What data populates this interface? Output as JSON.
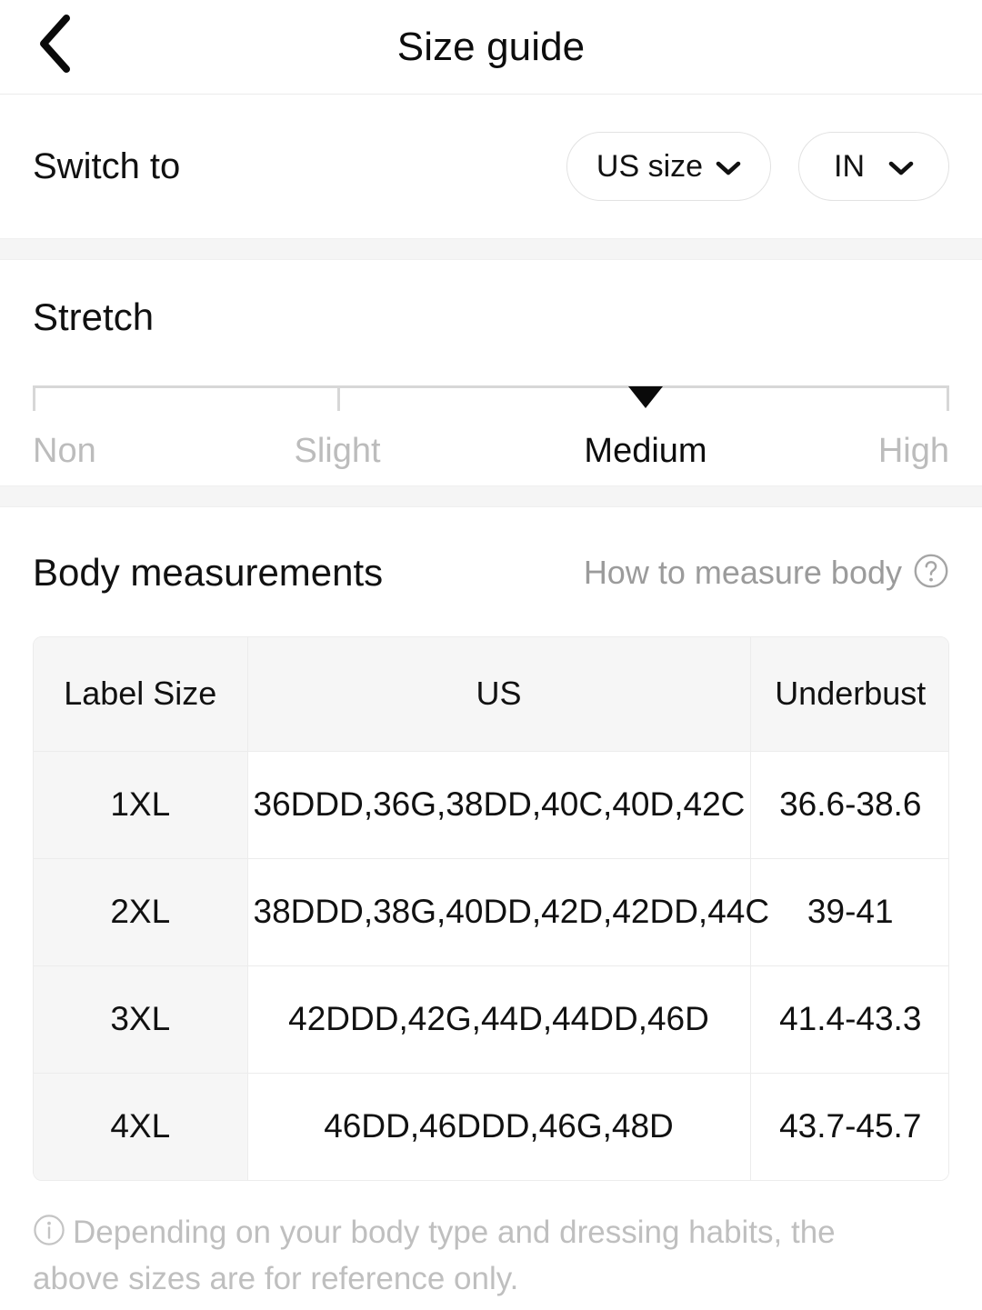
{
  "appbar": {
    "back_icon": "chevron-left-icon",
    "title": "Size guide"
  },
  "switch": {
    "label": "Switch to",
    "size_system": {
      "value": "US size",
      "icon": "chevron-down-icon"
    },
    "unit": {
      "value": "IN",
      "icon": "chevron-down-icon"
    }
  },
  "stretch": {
    "title": "Stretch",
    "levels": [
      "Non",
      "Slight",
      "Medium",
      "High"
    ],
    "selected": "Medium",
    "selected_index": 2
  },
  "body_measurements": {
    "title": "Body measurements",
    "how_to_measure": {
      "label": "How to measure body",
      "icon": "question-circle-icon"
    },
    "table": {
      "columns": [
        "Label Size",
        "US",
        "Underbust"
      ],
      "rows": [
        [
          "1XL",
          "36DDD,36G,38DD,40C,40D,42C",
          "36.6-38.6"
        ],
        [
          "2XL",
          "38DDD,38G,40DD,42D,42DD,44C",
          "39-41"
        ],
        [
          "3XL",
          "42DDD,42G,44D,44DD,46D",
          "41.4-43.3"
        ],
        [
          "4XL",
          "46DD,46DDD,46G,48D",
          "43.7-45.7"
        ]
      ]
    }
  },
  "note": {
    "icon": "info-circle-icon",
    "text": "Depending on your body type and dressing habits, the above sizes are for reference only."
  },
  "colors": {
    "text_primary": "#111111",
    "text_muted": "#bcbcbc",
    "band": "#f5f5f5",
    "header_cell": "#f6f6f6",
    "border": "#ececec",
    "marker": "#0a0a0a"
  }
}
